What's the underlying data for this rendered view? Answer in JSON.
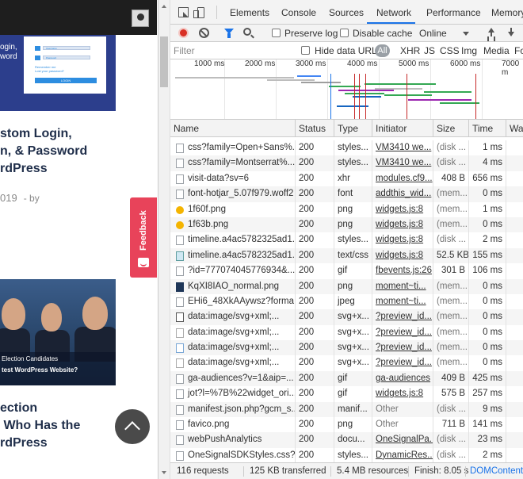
{
  "page": {
    "login_image_text": "ogin,\nword",
    "login_card": {
      "username_label": "Username",
      "password_label": "Password",
      "button_label": "LOGIN",
      "link_text": "Remember me\nLost your password?"
    },
    "headline_1": "stom Login,\nn, & Password\nrdPress",
    "date_text": "019",
    "by_text": "- by",
    "feedback_label": "Feedback",
    "photo_caption_1": "Election Candidates",
    "photo_caption_2": "test WordPress Website?",
    "headline_2": "ection\n Who Has the\nrdPress"
  },
  "devtools": {
    "tabs": [
      "Elements",
      "Console",
      "Sources",
      "Network",
      "Performance",
      "Memory"
    ],
    "active_tab": "Network",
    "toolbar": {
      "preserve_log": "Preserve log",
      "disable_cache": "Disable cache",
      "throttle": "Online"
    },
    "filter": {
      "placeholder": "Filter",
      "hide_data_urls": "Hide data URLs",
      "all": "All",
      "types": [
        "XHR",
        "JS",
        "CSS",
        "Img",
        "Media",
        "Fo"
      ]
    },
    "timeline_ticks": [
      "1000 ms",
      "2000 ms",
      "3000 ms",
      "4000 ms",
      "5000 ms",
      "6000 ms",
      "7000 m"
    ],
    "columns": [
      "Name",
      "Status",
      "Type",
      "Initiator",
      "Size",
      "Time",
      "Wa"
    ],
    "rows": [
      {
        "icon": "file",
        "name": "css?family=Open+Sans%...",
        "status": "200",
        "type": "styles...",
        "initiator": "VM3410 we...",
        "size": "(disk ...",
        "time": "1 ms"
      },
      {
        "icon": "file",
        "name": "css?family=Montserrat%...",
        "status": "200",
        "type": "styles...",
        "initiator": "VM3410 we...",
        "size": "(disk ...",
        "time": "4 ms"
      },
      {
        "icon": "file",
        "name": "visit-data?sv=6",
        "status": "200",
        "type": "xhr",
        "initiator": "modules.cf9...",
        "size": "408 B",
        "time": "656 ms"
      },
      {
        "icon": "file",
        "name": "font-hotjar_5.07f979.woff2",
        "status": "200",
        "type": "font",
        "initiator": "addthis_wid...",
        "size": "(mem...",
        "time": "0 ms"
      },
      {
        "icon": "emoji",
        "name": "1f60f.png",
        "status": "200",
        "type": "png",
        "initiator": "widgets.js:8",
        "size": "(mem...",
        "time": "1 ms"
      },
      {
        "icon": "emoji",
        "name": "1f63b.png",
        "status": "200",
        "type": "png",
        "initiator": "widgets.js:8",
        "size": "(mem...",
        "time": "0 ms"
      },
      {
        "icon": "file",
        "name": "timeline.a4ac5782325ad1...",
        "status": "200",
        "type": "styles...",
        "initiator": "widgets.js:8",
        "size": "(disk ...",
        "time": "2 ms"
      },
      {
        "icon": "image",
        "name": "timeline.a4ac5782325ad1...",
        "status": "200",
        "type": "text/css",
        "initiator": "widgets.js:8",
        "size": "52.5 KB",
        "time": "155 ms"
      },
      {
        "icon": "file",
        "name": "?id=777074045776934&...",
        "status": "200",
        "type": "gif",
        "initiator": "fbevents.js:26",
        "size": "301 B",
        "time": "106 ms"
      },
      {
        "icon": "avatar",
        "name": "KqXI8IAO_normal.png",
        "status": "200",
        "type": "png",
        "initiator": "moment~ti...",
        "size": "(mem...",
        "time": "0 ms"
      },
      {
        "icon": "file",
        "name": "EHi6_48XkAAywsz?forma...",
        "status": "200",
        "type": "jpeg",
        "initiator": "moment~ti...",
        "size": "(mem...",
        "time": "0 ms"
      },
      {
        "icon": "svg-check",
        "name": "data:image/svg+xml;...",
        "status": "200",
        "type": "svg+x...",
        "initiator": "?preview_id...",
        "size": "(mem...",
        "time": "0 ms"
      },
      {
        "icon": "svg-dot",
        "name": "data:image/svg+xml;...",
        "status": "200",
        "type": "svg+x...",
        "initiator": "?preview_id...",
        "size": "(mem...",
        "time": "0 ms"
      },
      {
        "icon": "svg-circle",
        "name": "data:image/svg+xml;...",
        "status": "200",
        "type": "svg+x...",
        "initiator": "?preview_id...",
        "size": "(mem...",
        "time": "0 ms"
      },
      {
        "icon": "svg-dot",
        "name": "data:image/svg+xml;...",
        "status": "200",
        "type": "svg+x...",
        "initiator": "?preview_id...",
        "size": "(mem...",
        "time": "0 ms"
      },
      {
        "icon": "file",
        "name": "ga-audiences?v=1&aip=...",
        "status": "200",
        "type": "gif",
        "initiator": "ga-audiences",
        "size": "409 B",
        "time": "425 ms"
      },
      {
        "icon": "file",
        "name": "jot?l=%7B%22widget_ori...",
        "status": "200",
        "type": "gif",
        "initiator": "widgets.js:8",
        "size": "575 B",
        "time": "257 ms"
      },
      {
        "icon": "file",
        "name": "manifest.json.php?gcm_s...",
        "status": "200",
        "type": "manif...",
        "initiator": "Other",
        "size": "(disk ...",
        "time": "9 ms"
      },
      {
        "icon": "file",
        "name": "favico.png",
        "status": "200",
        "type": "png",
        "initiator": "Other",
        "size": "711 B",
        "time": "141 ms"
      },
      {
        "icon": "file",
        "name": "webPushAnalytics",
        "status": "200",
        "type": "docu...",
        "initiator": "OneSignalPa...",
        "size": "(disk ...",
        "time": "23 ms"
      },
      {
        "icon": "file",
        "name": "OneSignalSDKStyles.css?...",
        "status": "200",
        "type": "styles...",
        "initiator": "DynamicRes...",
        "size": "(disk ...",
        "time": "2 ms"
      }
    ],
    "status_bar": {
      "requests": "116 requests",
      "transferred": "125 KB transferred",
      "resources": "5.4 MB resources",
      "finish": "Finish: 8.05 s",
      "dcl": "DOMContentL"
    }
  }
}
